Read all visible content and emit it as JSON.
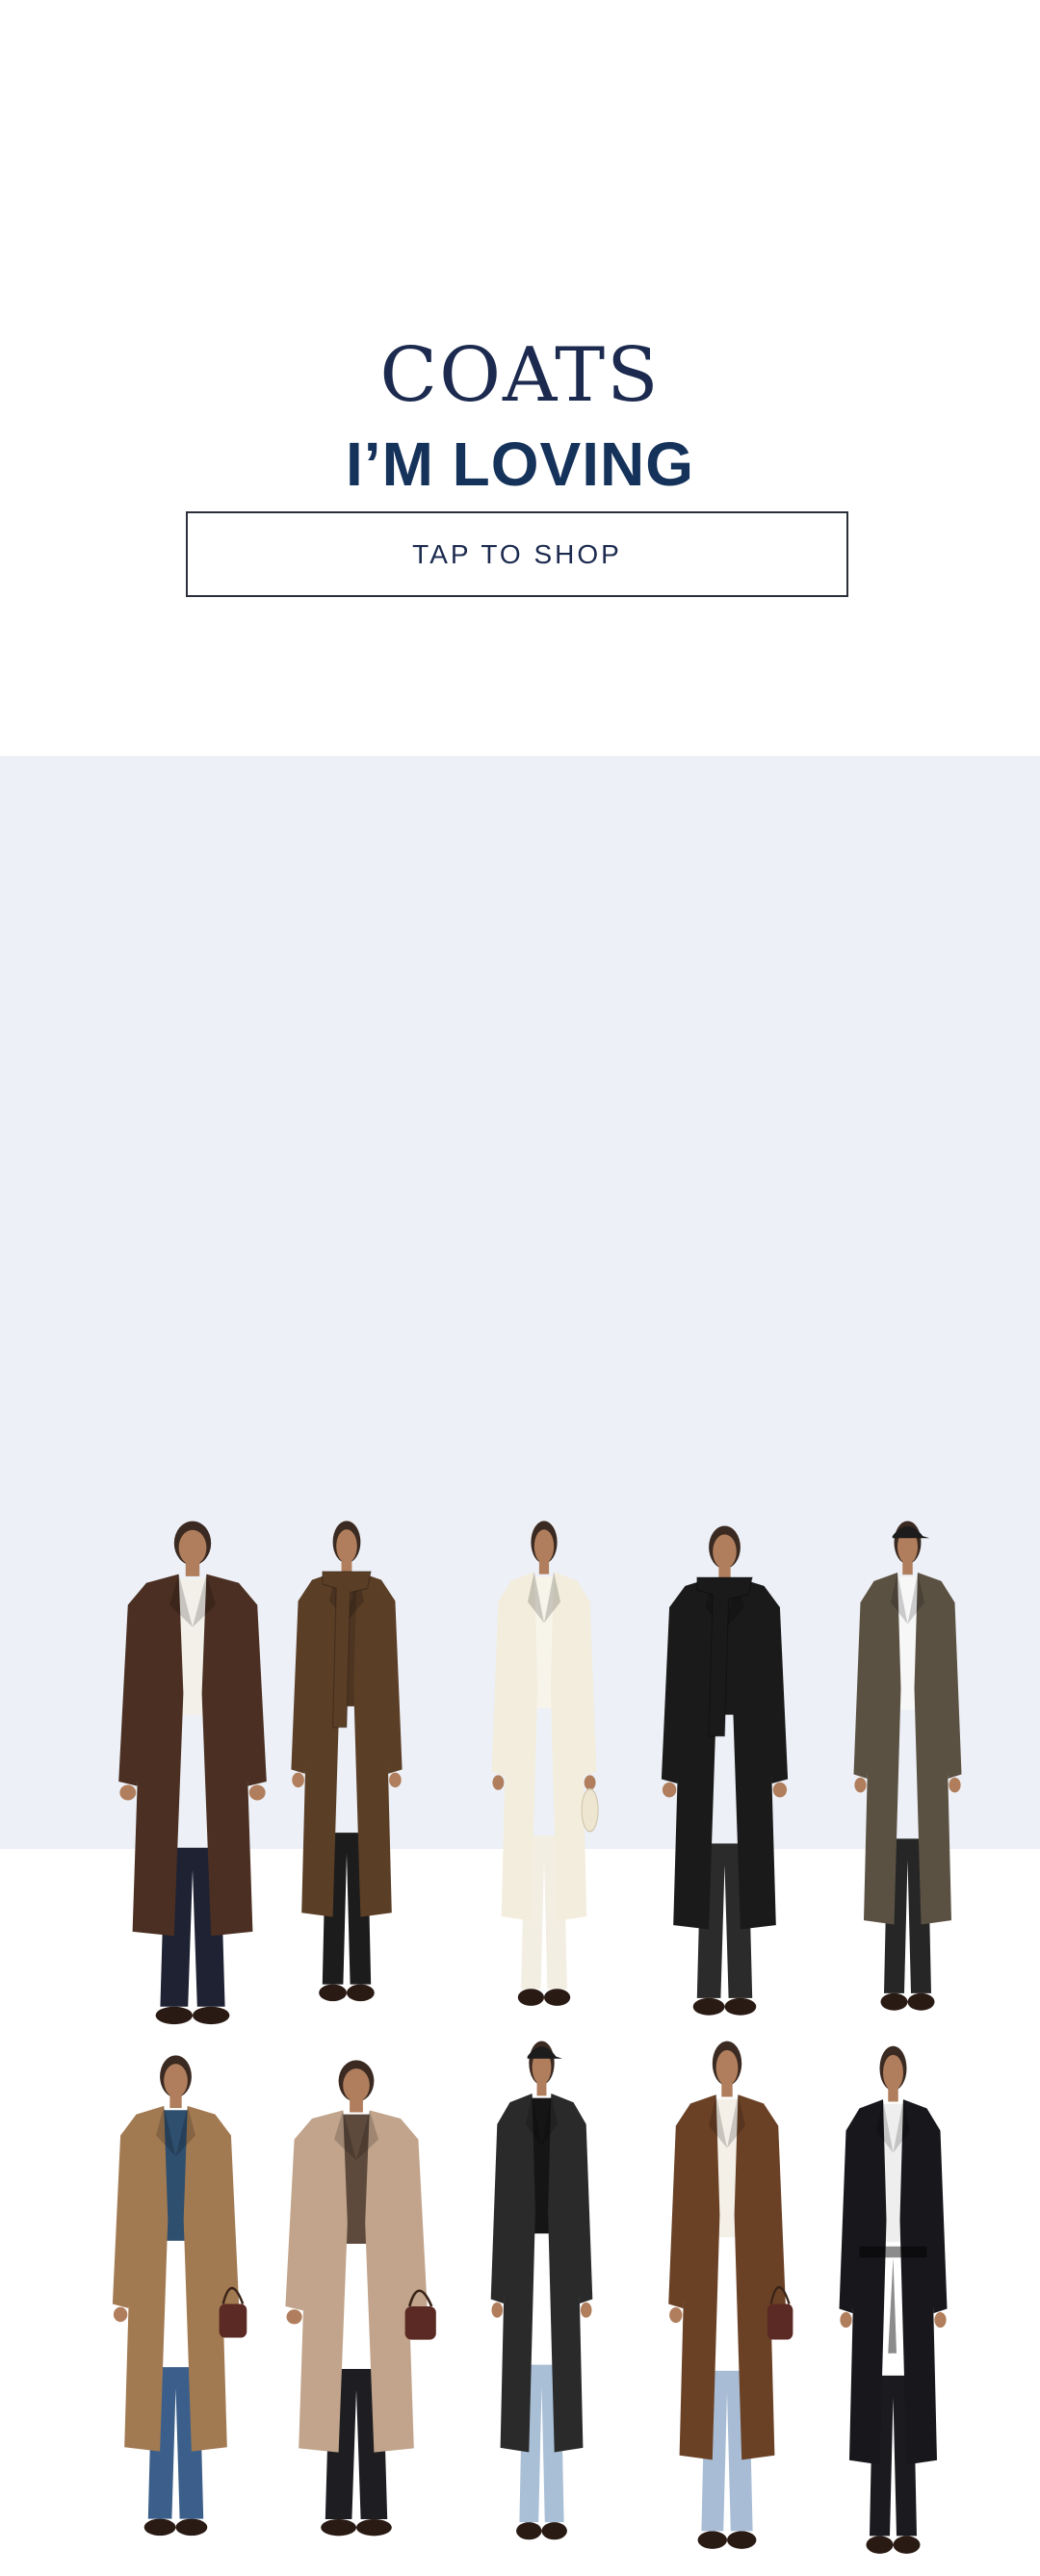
{
  "hero": {
    "title_top": "COATS",
    "title_bottom": "I’M LOVING",
    "cta_label": "TAP TO SHOP"
  },
  "colors": {
    "title_navy": "#14325a",
    "gallery_background": "#edf0f6",
    "button_border": "#2b2f3a"
  },
  "gallery": {
    "looks": [
      {
        "name": "look-1",
        "coat_color": "#4a2f22",
        "top_color": "#f3f0ea",
        "bottom_color": "#1e2233",
        "accessory": "none"
      },
      {
        "name": "look-2",
        "coat_color": "#5a3e26",
        "top_color": "#4e3522",
        "bottom_color": "#1c1c1c",
        "accessory": "scarf"
      },
      {
        "name": "look-3",
        "coat_color": "#f2eddc",
        "top_color": "#f7f4ea",
        "bottom_color": "#f3eee2",
        "accessory": "shoulder-bag"
      },
      {
        "name": "look-4",
        "coat_color": "#1a1a1a",
        "top_color": "#1a1a1a",
        "bottom_color": "#2b2b2b",
        "accessory": "scarf"
      },
      {
        "name": "look-5",
        "coat_color": "#5b5143",
        "top_color": "#f7f7f7",
        "bottom_color": "#262626",
        "accessory": "cap"
      },
      {
        "name": "look-6",
        "coat_color": "#a27a52",
        "top_color": "#2f4f6e",
        "bottom_color": "#3b5f8a",
        "accessory": "handbag"
      },
      {
        "name": "look-7",
        "coat_color": "#c1a48b",
        "top_color": "#5e4a3c",
        "bottom_color": "#1e1e22",
        "accessory": "handbag"
      },
      {
        "name": "look-8",
        "coat_color": "#2a2a2a",
        "top_color": "#151515",
        "bottom_color": "#a9bfd6",
        "accessory": "cap"
      },
      {
        "name": "look-9",
        "coat_color": "#6b4126",
        "top_color": "#f4f0e7",
        "bottom_color": "#a8bdd5",
        "accessory": "handbag"
      },
      {
        "name": "look-10",
        "coat_color": "#17171c",
        "top_color": "#eeeeee",
        "bottom_color": "#1b1b1f",
        "accessory": "belt"
      }
    ]
  }
}
